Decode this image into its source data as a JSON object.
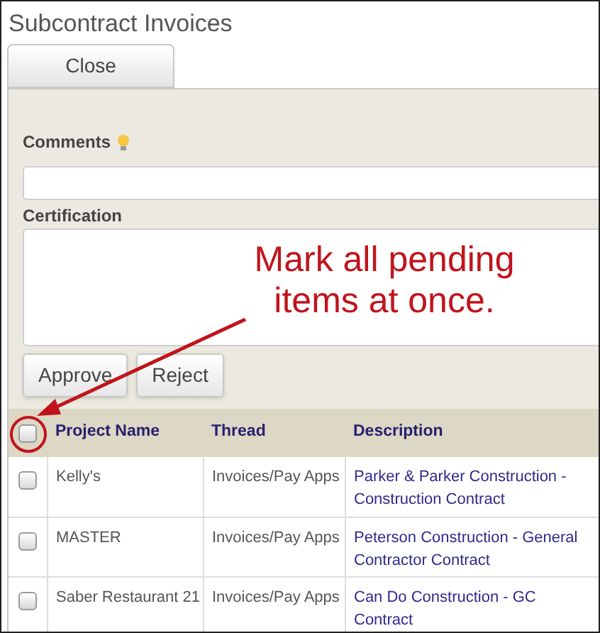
{
  "window": {
    "title": "Subcontract Invoices"
  },
  "close_button": "Close",
  "comments": {
    "label": "Comments"
  },
  "certification": {
    "label": "Certification"
  },
  "actions": [
    "Approve",
    "Reject"
  ],
  "table": {
    "select_all": {
      "checked": false
    },
    "columns": [
      "Project Name",
      "Thread",
      "Description"
    ],
    "rows": [
      {
        "checked": false,
        "cells": [
          "Kelly's",
          "Invoices/Pay Apps",
          "Parker & Parker Construction - Construction Contract"
        ]
      },
      {
        "checked": false,
        "cells": [
          "MASTER",
          "Invoices/Pay Apps",
          "Peterson Construction - General Contractor Contract"
        ]
      },
      {
        "checked": false,
        "cells": [
          "Saber Restaurant 21",
          "Invoices/Pay Apps",
          "Can Do Construction - GC Contract"
        ]
      }
    ]
  },
  "annotation": {
    "text": "Mark all pending items at once."
  }
}
